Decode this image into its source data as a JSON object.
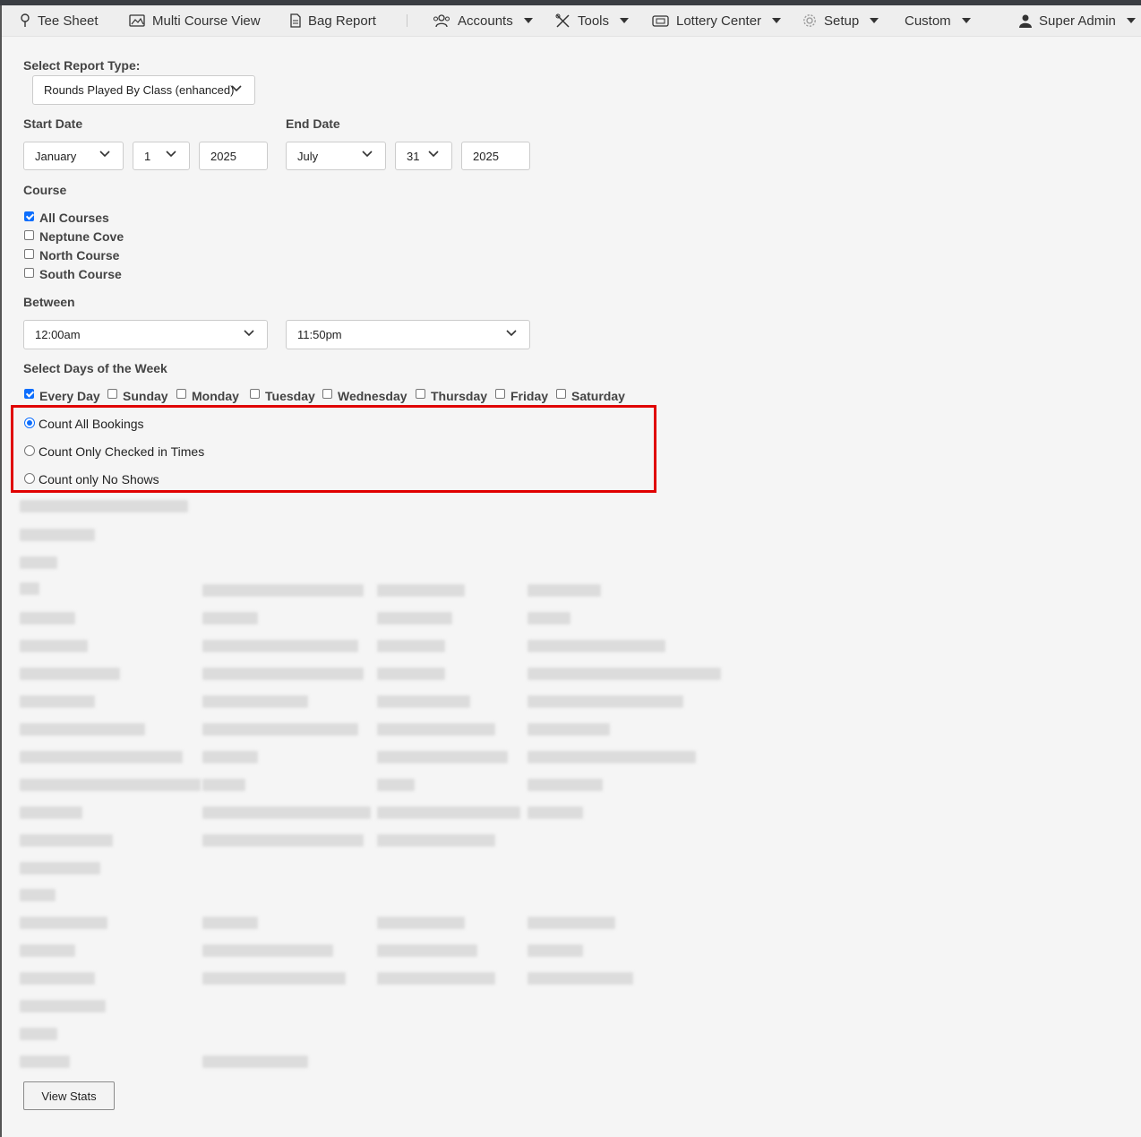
{
  "nav": {
    "items": [
      {
        "label": "Tee Sheet",
        "icon": "pin-icon"
      },
      {
        "label": "Multi Course View",
        "icon": "image-icon"
      },
      {
        "label": "Bag Report",
        "icon": "document-icon"
      },
      {
        "label": "Accounts",
        "icon": "users-icon"
      },
      {
        "label": "Tools",
        "icon": "tools-icon"
      },
      {
        "label": "Lottery Center",
        "icon": "ticket-icon"
      },
      {
        "label": "Setup",
        "icon": "gear-icon"
      },
      {
        "label": "Custom",
        "icon": ""
      },
      {
        "label": "Super Admin",
        "icon": "user-icon"
      }
    ]
  },
  "report": {
    "type_label": "Select Report Type:",
    "type_value": "Rounds Played By Class (enhanced)"
  },
  "start_date": {
    "label": "Start Date",
    "month": "January",
    "day": "1",
    "year": "2025"
  },
  "end_date": {
    "label": "End Date",
    "month": "July",
    "day": "31",
    "year": "2025"
  },
  "course": {
    "label": "Course",
    "options": [
      {
        "label": "All Courses",
        "checked": true
      },
      {
        "label": "Neptune Cove",
        "checked": false
      },
      {
        "label": "North Course",
        "checked": false
      },
      {
        "label": "South Course",
        "checked": false
      }
    ]
  },
  "between": {
    "label": "Between",
    "from": "12:00am",
    "to": "11:50pm"
  },
  "days": {
    "label": "Select Days of the Week",
    "options": [
      {
        "label": "Every Day",
        "checked": true
      },
      {
        "label": "Sunday",
        "checked": false
      },
      {
        "label": "Monday",
        "checked": false
      },
      {
        "label": "Tuesday",
        "checked": false
      },
      {
        "label": "Wednesday",
        "checked": false
      },
      {
        "label": "Thursday",
        "checked": false
      },
      {
        "label": "Friday",
        "checked": false
      },
      {
        "label": "Saturday",
        "checked": false
      }
    ]
  },
  "count_mode": {
    "options": [
      {
        "label": "Count All Bookings",
        "selected": true
      },
      {
        "label": "Count Only Checked in Times",
        "selected": false
      },
      {
        "label": "Count only No Shows",
        "selected": false
      }
    ]
  },
  "colors": {
    "accent": "#0d6efd",
    "highlight": "#e00000"
  },
  "view_button": "View Stats"
}
